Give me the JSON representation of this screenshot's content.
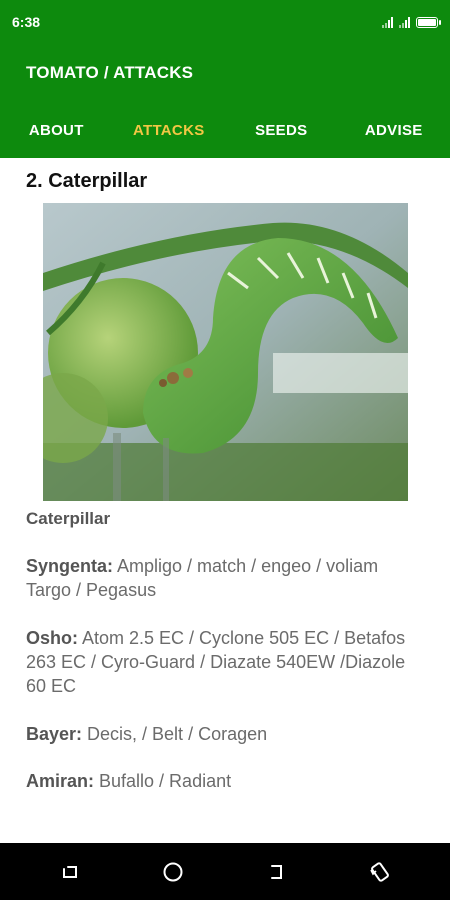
{
  "status_bar": {
    "time": "6:38",
    "icons": [
      "signal-icon",
      "signal-icon",
      "battery-icon"
    ]
  },
  "app_bar": {
    "title": "TOMATO / ATTACKS"
  },
  "tabs": [
    {
      "label": "ABOUT",
      "active": false
    },
    {
      "label": "ATTACKS",
      "active": true
    },
    {
      "label": "SEEDS",
      "active": false
    },
    {
      "label": "ADVISE",
      "active": false
    }
  ],
  "content": {
    "heading": "2. Caterpillar",
    "image_alt_icon": "caterpillar-on-tomato-photo",
    "caption": "Caterpillar",
    "remedies": [
      {
        "brand": "Syngenta:",
        "products": " Ampligo / match / engeo / voliam Targo / Pegasus"
      },
      {
        "brand": "Osho:",
        "products": " Atom 2.5 EC / Cyclone 505 EC / Betafos 263 EC / Cyro-Guard / Diazate 540EW /Diazole 60 EC"
      },
      {
        "brand": "Bayer:",
        "products": " Decis, / Belt / Coragen"
      },
      {
        "brand": "Amiran:",
        "products": " Bufallo / Radiant"
      }
    ]
  },
  "nav_bar": {
    "buttons": [
      "recent-apps-icon",
      "home-icon",
      "back-icon",
      "rotate-icon"
    ]
  },
  "colors": {
    "primary": "#0d8a0d",
    "tab_active": "#f2c744",
    "text": "#6b6b6b"
  }
}
